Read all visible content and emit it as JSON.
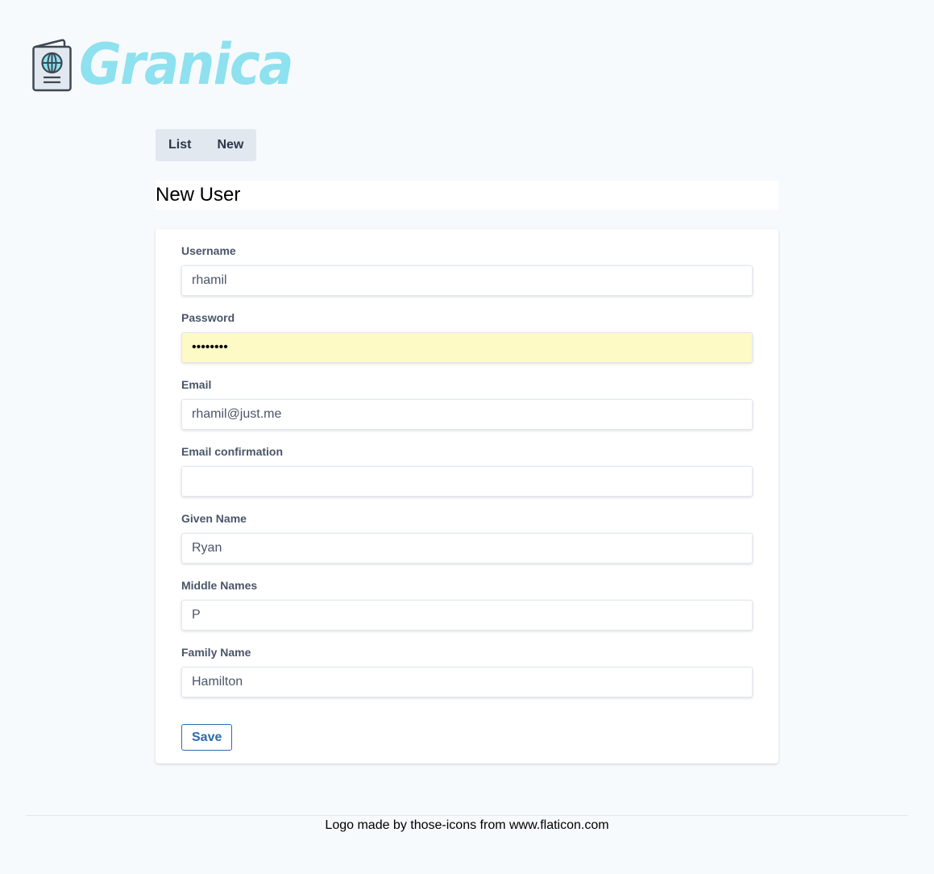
{
  "brand": {
    "name": "Granica",
    "icon": "passport-globe-icon",
    "color": "#8ee1ef"
  },
  "tabs": [
    {
      "label": "List"
    },
    {
      "label": "New"
    }
  ],
  "page_title": "New User",
  "form": {
    "fields": [
      {
        "label": "Username",
        "value": "rhamil",
        "type": "text"
      },
      {
        "label": "Password",
        "value": "••••••••",
        "type": "password"
      },
      {
        "label": "Email",
        "value": "rhamil@just.me",
        "type": "text"
      },
      {
        "label": "Email confirmation",
        "value": "",
        "type": "text"
      },
      {
        "label": "Given Name",
        "value": "Ryan",
        "type": "text"
      },
      {
        "label": "Middle Names",
        "value": "P",
        "type": "text"
      },
      {
        "label": "Family Name",
        "value": "Hamilton",
        "type": "text"
      }
    ],
    "save_label": "Save"
  },
  "footer": {
    "credit": "Logo made by those-icons from www.flaticon.com"
  }
}
